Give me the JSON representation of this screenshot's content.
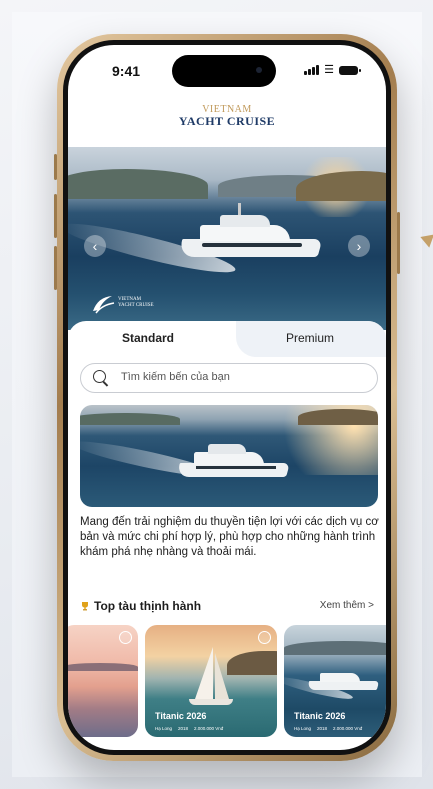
{
  "status_bar": {
    "time": "9:41"
  },
  "brand": {
    "line1": "VIETNAM",
    "line2": "YACHT CRUISE"
  },
  "hero": {
    "logo_line1": "VIETNAM",
    "logo_line2": "YACHT CRUISE"
  },
  "tabs": [
    {
      "label": "Standard",
      "active": true
    },
    {
      "label": "Premium",
      "active": false
    }
  ],
  "search": {
    "placeholder": "Tìm kiếm bến của bạn"
  },
  "description": "Mang đến trải nghiệm du thuyền tiện lợi với các dịch vụ cơ bản và mức chi phí hợp lý, phù hợp cho những hành trình khám phá nhẹ nhàng và thoải mái.",
  "top_section": {
    "title": "Top tàu thịnh hành",
    "see_more": "Xem thêm >"
  },
  "top_cards": [
    {
      "name": "",
      "location": "",
      "year": "",
      "price": ""
    },
    {
      "name": "Titanic 2026",
      "location": "Hạ Long",
      "year": "2018",
      "price": "2.000.000 Vnđ"
    },
    {
      "name": "Titanic 2026",
      "location": "Hạ Long",
      "year": "2018",
      "price": "2.000.000 Vnđ"
    }
  ],
  "colors": {
    "brand_gold": "#c19a5b",
    "brand_navy": "#1e3a66",
    "phone_frame": "#a37d4e"
  }
}
